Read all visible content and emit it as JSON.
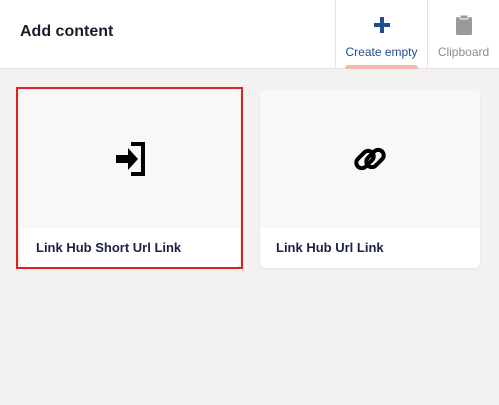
{
  "header": {
    "title": "Add content",
    "tabs": [
      {
        "label": "Create empty",
        "icon": "plus-icon",
        "active": true
      },
      {
        "label": "Clipboard",
        "icon": "clipboard-icon",
        "active": false
      }
    ]
  },
  "cards": [
    {
      "label": "Link Hub Short Url Link",
      "icon": "sign-in-icon",
      "selected": true
    },
    {
      "label": "Link Hub Url Link",
      "icon": "link-icon",
      "selected": false
    }
  ],
  "colors": {
    "accent": "#1f4d8f",
    "active_tab_underline": "#f2b9ad",
    "selection_outline": "#e02020",
    "background": "#f3f1f1"
  }
}
